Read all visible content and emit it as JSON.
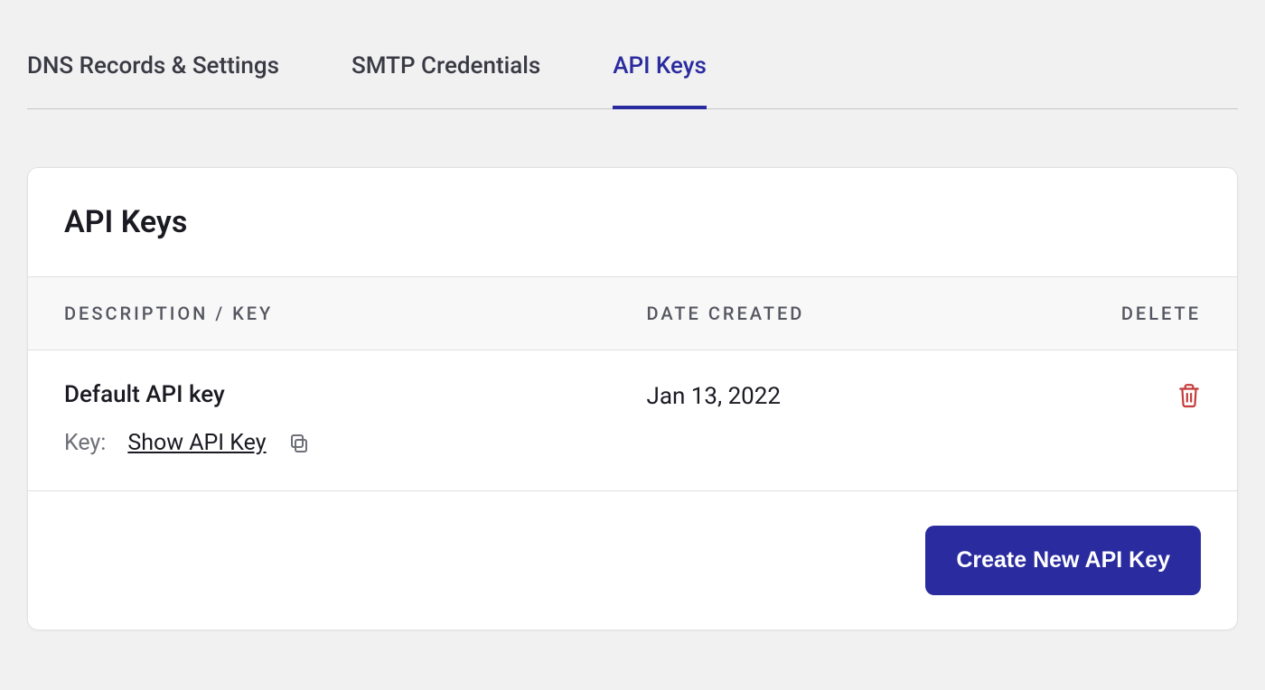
{
  "tabs": {
    "dns": "DNS Records & Settings",
    "smtp": "SMTP Credentials",
    "api": "API Keys"
  },
  "card": {
    "title": "API Keys",
    "columns": {
      "description": "DESCRIPTION / KEY",
      "date": "DATE CREATED",
      "delete": "DELETE"
    },
    "rows": [
      {
        "description": "Default API key",
        "key_label": "Key:",
        "show_label": "Show API Key",
        "date_created": "Jan 13, 2022"
      }
    ],
    "create_button": "Create New API Key"
  }
}
